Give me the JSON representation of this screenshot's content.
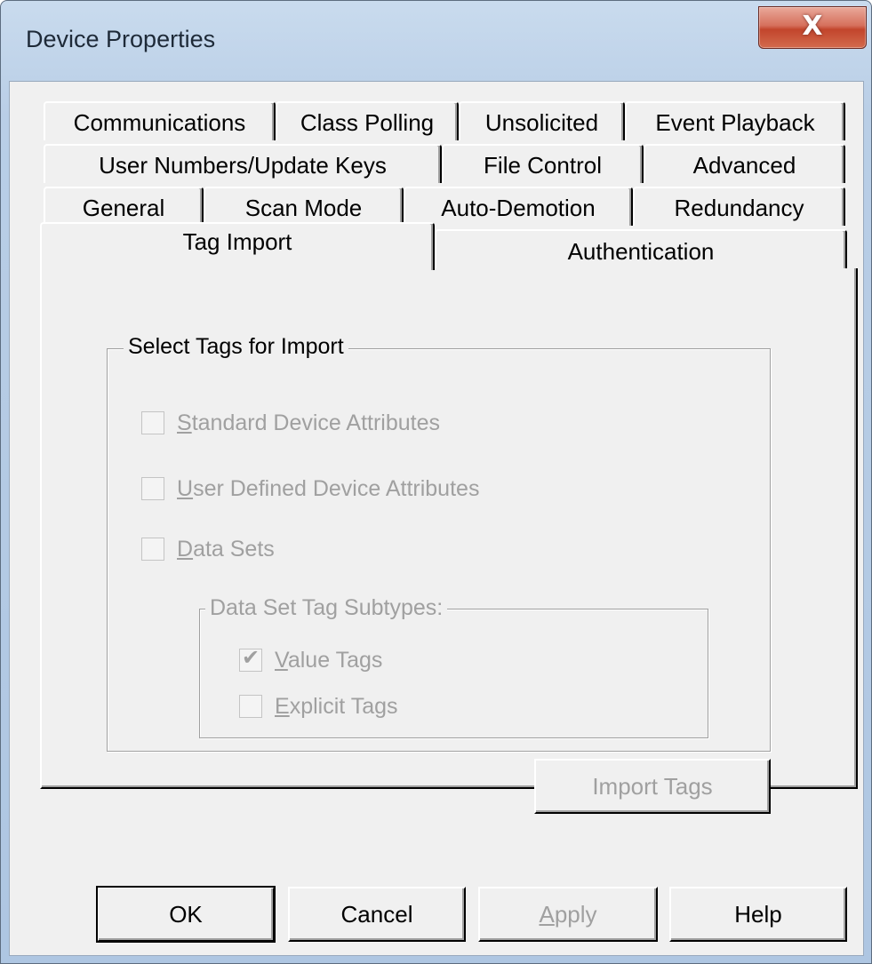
{
  "window": {
    "title": "Device Properties",
    "close_glyph": "X"
  },
  "tabs": {
    "row1": [
      {
        "label": "Communications"
      },
      {
        "label": "Class Polling"
      },
      {
        "label": "Unsolicited"
      },
      {
        "label": "Event Playback"
      }
    ],
    "row2": [
      {
        "label": "User Numbers/Update Keys"
      },
      {
        "label": "File Control"
      },
      {
        "label": "Advanced"
      }
    ],
    "row3": [
      {
        "label": "General"
      },
      {
        "label": "Scan Mode"
      },
      {
        "label": "Auto-Demotion"
      },
      {
        "label": "Redundancy"
      }
    ],
    "row4": [
      {
        "label": "Tag Import",
        "active": true
      },
      {
        "label": "Authentication"
      }
    ]
  },
  "tag_import": {
    "group_label": "Select Tags for Import",
    "options": [
      {
        "mnemonic": "S",
        "rest": "tandard Device Attributes",
        "checked": false,
        "enabled": false
      },
      {
        "mnemonic": "U",
        "rest": "ser Defined Device Attributes",
        "checked": false,
        "enabled": false
      },
      {
        "mnemonic": "D",
        "rest": "ata Sets",
        "checked": false,
        "enabled": false
      }
    ],
    "subgroup_label": "Data Set Tag Subtypes:",
    "sub_options": [
      {
        "mnemonic": "V",
        "rest": "alue Tags",
        "checked": true,
        "enabled": false
      },
      {
        "mnemonic": "E",
        "rest": "xplicit Tags",
        "checked": false,
        "enabled": false
      }
    ],
    "import_button": "Import Tags"
  },
  "buttons": {
    "ok": "OK",
    "cancel": "Cancel",
    "apply_mnemonic": "A",
    "apply_rest": "pply",
    "help": "Help"
  },
  "colors": {
    "dialog_face": "#f0f0f0",
    "disabled_text": "#a0a0a0",
    "close_button": "#c2452c"
  }
}
